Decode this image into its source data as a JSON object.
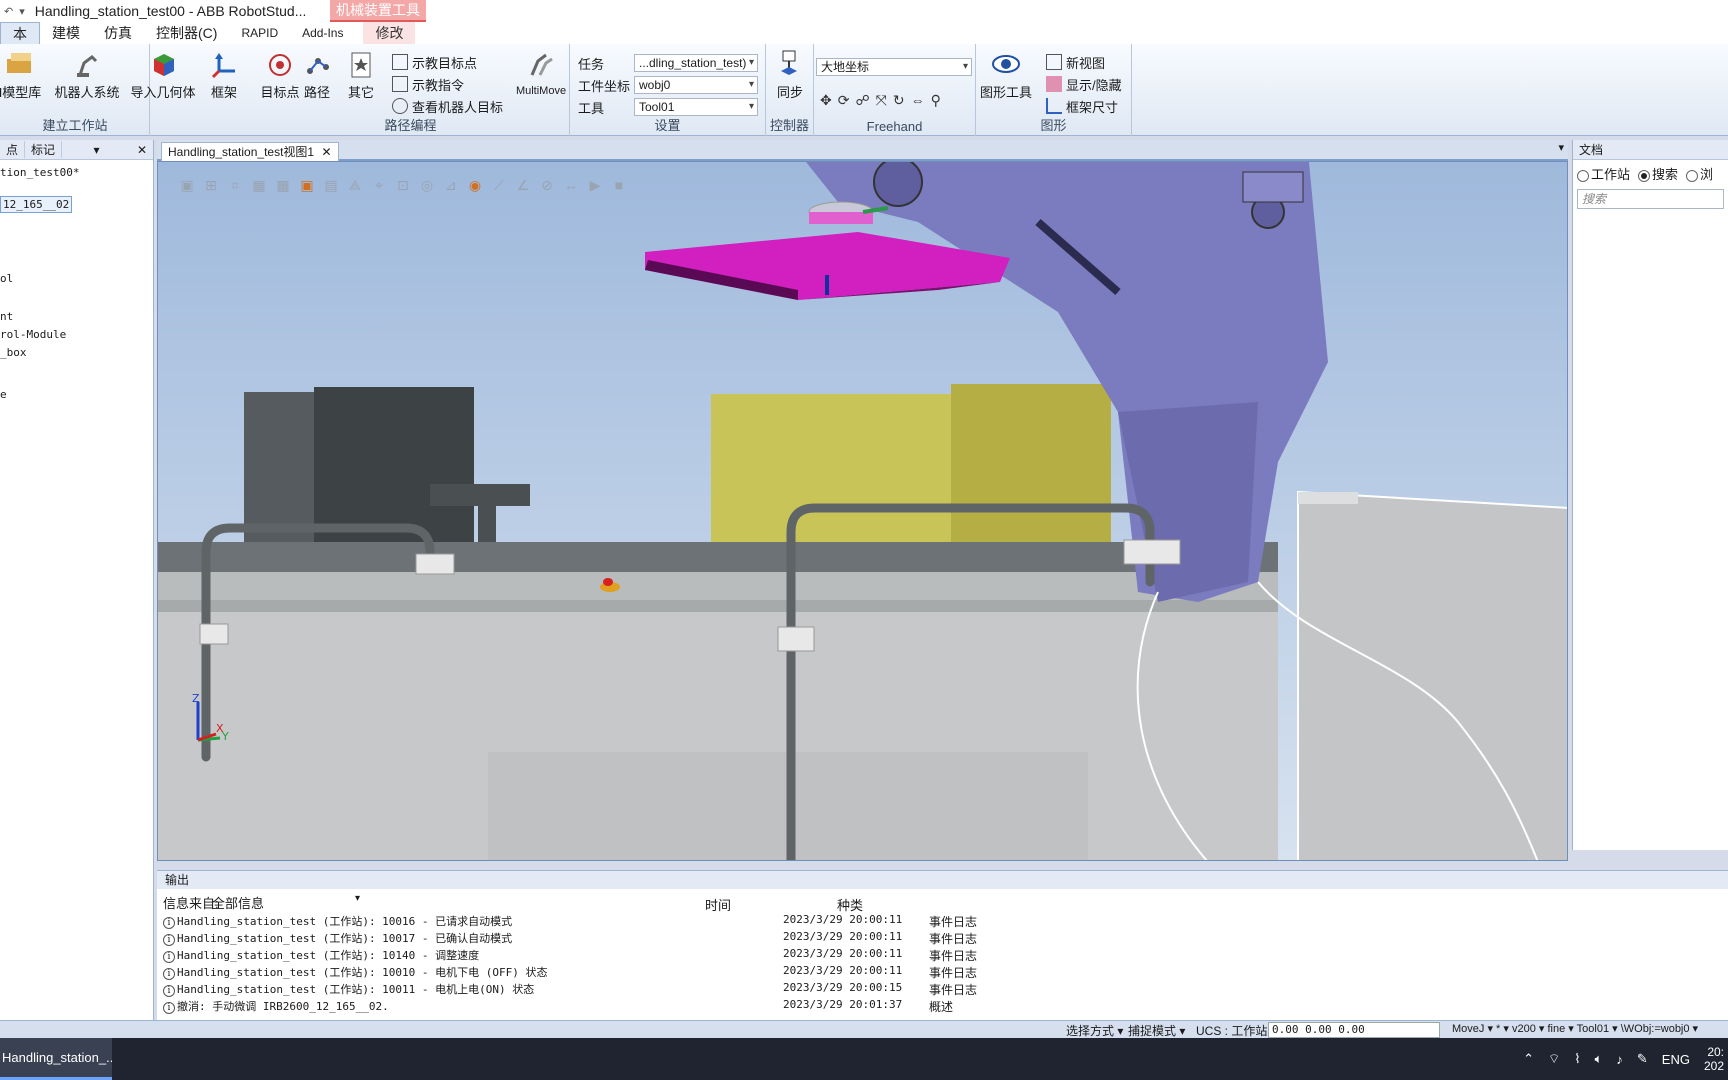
{
  "window": {
    "title": "Handling_station_test00 - ABB RobotStud...",
    "context_tab_group": "机械装置工具"
  },
  "tabs": [
    "本",
    "建模",
    "仿真",
    "控制器(C)",
    "RAPID",
    "Add-Ins",
    "修改"
  ],
  "ribbon": {
    "group_build": {
      "label": "建立工作站",
      "buttons": [
        "I模型库",
        "机器人系统",
        "导入几何体",
        "框架"
      ]
    },
    "group_path": {
      "label": "路径编程",
      "buttons": [
        "目标点",
        "路径",
        "其它"
      ],
      "small": [
        "示教目标点",
        "示教指令",
        "查看机器人目标"
      ],
      "multimove": "MultiMove"
    },
    "group_settings": {
      "label": "设置",
      "task_label": "任务",
      "task_value": "...dling_station_test)",
      "wobj_label": "工件坐标",
      "wobj_value": "wobj0",
      "tool_label": "工具",
      "tool_value": "Tool01"
    },
    "group_controller": {
      "label": "控制器",
      "sync": "同步"
    },
    "group_freehand": {
      "label": "Freehand",
      "frame_value": "大地坐标"
    },
    "group_graphics": {
      "label": "图形",
      "tools": "图形工具",
      "small": [
        "新视图",
        "显示/隐藏",
        "框架尺寸"
      ]
    }
  },
  "left_panel": {
    "tabs": [
      "点",
      "标记"
    ],
    "tree": [
      "tion_test00*",
      "12_165__02",
      "ol",
      "nt",
      "rol-Module",
      "_box",
      "e"
    ]
  },
  "viewport": {
    "tab_label": "Handling_station_test视图1",
    "axis_labels": [
      "Z",
      "Y",
      "X"
    ],
    "colors": {
      "sky_top": "#9fb9dc",
      "sky_bottom": "#d7e2ef",
      "robot": "#7b7bbf",
      "gripper": "#d21fc0",
      "box": "#c8c45c"
    }
  },
  "right_panel": {
    "header": "文档",
    "radios": [
      {
        "label": "工作站",
        "checked": false
      },
      {
        "label": "搜索",
        "checked": true
      },
      {
        "label": "浏",
        "checked": false
      }
    ],
    "search_placeholder": "搜索"
  },
  "output": {
    "tab": "输出",
    "filter_label": "信息来自:",
    "filter_value": "全部信息",
    "col_time": "时间",
    "col_kind": "种类",
    "rows": [
      {
        "msg": "Handling_station_test (工作站): 10016 - 已请求自动模式",
        "time": "2023/3/29 20:00:11",
        "kind": "事件日志"
      },
      {
        "msg": "Handling_station_test (工作站): 10017 - 已确认自动模式",
        "time": "2023/3/29 20:00:11",
        "kind": "事件日志"
      },
      {
        "msg": "Handling_station_test (工作站): 10140 - 调整速度",
        "time": "2023/3/29 20:00:11",
        "kind": "事件日志"
      },
      {
        "msg": "Handling_station_test (工作站): 10010 - 电机下电 (OFF) 状态",
        "time": "2023/3/29 20:00:11",
        "kind": "事件日志"
      },
      {
        "msg": "Handling_station_test (工作站): 10011 - 电机上电(ON) 状态",
        "time": "2023/3/29 20:00:15",
        "kind": "事件日志"
      },
      {
        "msg": "撤消: 手动微调 IRB2600_12_165__02.",
        "time": "2023/3/29 20:01:37",
        "kind": "概述"
      }
    ]
  },
  "status": {
    "select_mode": "选择方式",
    "snap_mode": "捕捉模式",
    "ucs": "UCS : 工作站",
    "coords": "0.00   0.00   0.00",
    "movej": "MoveJ",
    "star": "*",
    "speed": "v200",
    "zone": "fine",
    "tool": "Tool01",
    "wobj": "\\WObj:=wobj0"
  },
  "taskbar": {
    "app": "Handling_station_...",
    "lang": "ENG",
    "clock_time": "20:",
    "clock_date": "202"
  }
}
